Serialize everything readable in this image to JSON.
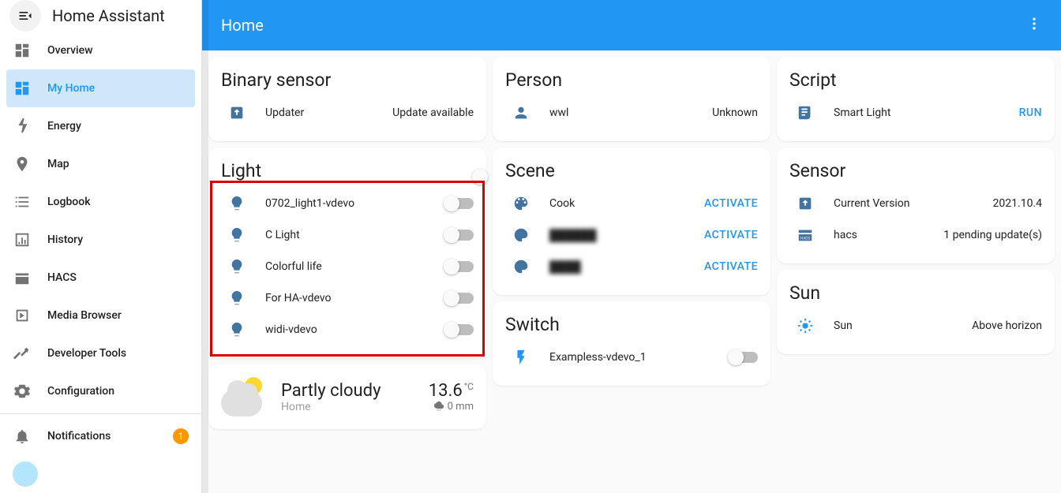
{
  "brand": "Home Assistant",
  "topbar": {
    "title": "Home"
  },
  "sidebar": {
    "items": [
      {
        "label": "Overview"
      },
      {
        "label": "My Home"
      },
      {
        "label": "Energy"
      },
      {
        "label": "Map"
      },
      {
        "label": "Logbook"
      },
      {
        "label": "History"
      },
      {
        "label": "HACS"
      },
      {
        "label": "Media Browser"
      },
      {
        "label": "Developer Tools"
      },
      {
        "label": "Configuration"
      }
    ],
    "notifications": {
      "label": "Notifications",
      "count": "1"
    }
  },
  "cards": {
    "binary_sensor": {
      "title": "Binary sensor",
      "item": {
        "label": "Updater",
        "value": "Update available"
      }
    },
    "light": {
      "title": "Light",
      "items": [
        {
          "label": "0702_light1-vdevo"
        },
        {
          "label": "C Light"
        },
        {
          "label": "Colorful life"
        },
        {
          "label": "For HA-vdevo"
        },
        {
          "label": "widi-vdevo"
        }
      ]
    },
    "weather": {
      "label": "Partly cloudy",
      "sub": "Home",
      "temp": "13.6",
      "temp_unit": "°C",
      "precip": "0 mm"
    },
    "person": {
      "title": "Person",
      "item": {
        "label": "wwl",
        "value": "Unknown"
      }
    },
    "scene": {
      "title": "Scene",
      "items": [
        {
          "label": "Cook",
          "action": "ACTIVATE"
        },
        {
          "label": "██████",
          "action": "ACTIVATE"
        },
        {
          "label": "████",
          "action": "ACTIVATE"
        }
      ]
    },
    "switch": {
      "title": "Switch",
      "item": {
        "label": "Exampless-vdevo_1"
      }
    },
    "script": {
      "title": "Script",
      "item": {
        "label": "Smart Light",
        "action": "RUN"
      }
    },
    "sensor": {
      "title": "Sensor",
      "items": [
        {
          "label": "Current Version",
          "value": "2021.10.4"
        },
        {
          "label": "hacs",
          "value": "1 pending update(s)"
        }
      ]
    },
    "sun": {
      "title": "Sun",
      "item": {
        "label": "Sun",
        "value": "Above horizon"
      }
    }
  }
}
